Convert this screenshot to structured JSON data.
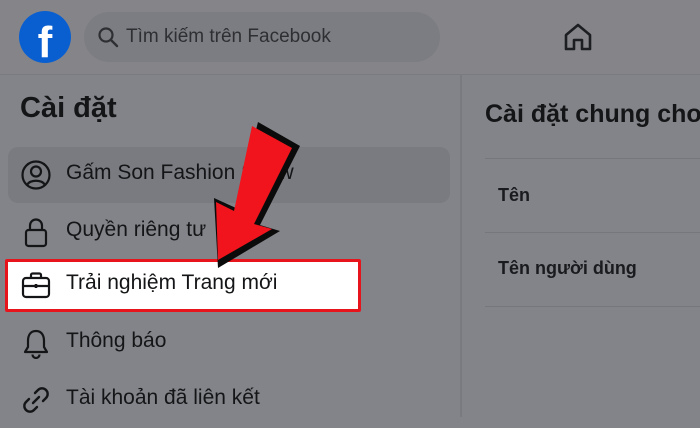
{
  "header": {
    "logo": "f",
    "search": {
      "placeholder": "Tìm kiếm trên Facebook"
    }
  },
  "sidebar": {
    "title": "Cài đặt",
    "items": [
      {
        "label": "Gấm Son Fashion Show",
        "icon": "profile-icon"
      },
      {
        "label": "Quyền riêng tư",
        "icon": "lock-icon"
      },
      {
        "label": "Trải nghiệm Trang mới",
        "icon": "briefcase-icon"
      },
      {
        "label": "Thông báo",
        "icon": "bell-icon"
      },
      {
        "label": "Tài khoản đã liên kết",
        "icon": "link-icon"
      }
    ]
  },
  "main": {
    "title": "Cài đặt chung cho",
    "rows": [
      "Tên",
      "Tên người dùng"
    ]
  },
  "colors": {
    "brand": "#0a5fd0",
    "highlight_border": "#e8141c",
    "arrow": "#f1141c"
  }
}
